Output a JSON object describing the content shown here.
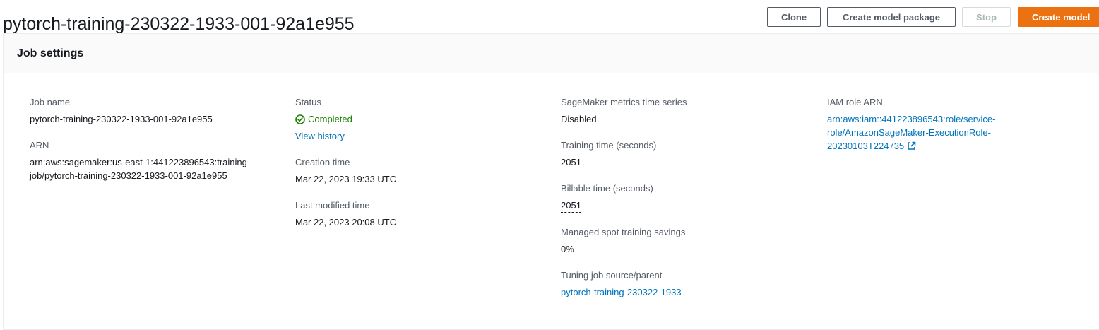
{
  "header": {
    "job_title": "pytorch-training-230322-1933-001-92a1e955",
    "buttons": {
      "clone": "Clone",
      "create_model_package": "Create model package",
      "stop": "Stop",
      "create_model": "Create model"
    },
    "colors": {
      "primary": "#ec7211",
      "link": "#0073bb",
      "success": "#1d8102"
    }
  },
  "job_settings": {
    "title": "Job settings",
    "job_name": {
      "label": "Job name",
      "value": "pytorch-training-230322-1933-001-92a1e955"
    },
    "arn": {
      "label": "ARN",
      "value_line1": "arn:aws:sagemaker:us-east-1:441223896543:training-",
      "value_line2": "job/pytorch-training-230322-1933-001-92a1e955"
    },
    "status": {
      "label": "Status",
      "value": "Completed",
      "icon": "check-circle-icon",
      "history_link": "View history"
    },
    "creation_time": {
      "label": "Creation time",
      "value": "Mar 22, 2023 19:33 UTC"
    },
    "last_modified_time": {
      "label": "Last modified time",
      "value": "Mar 22, 2023 20:08 UTC"
    },
    "metrics_time_series": {
      "label": "SageMaker metrics time series",
      "value": "Disabled"
    },
    "training_time": {
      "label": "Training time (seconds)",
      "value": "2051"
    },
    "billable_time": {
      "label": "Billable time (seconds)",
      "value": "2051"
    },
    "spot_savings": {
      "label": "Managed spot training savings",
      "value": "0%"
    },
    "tuning_job": {
      "label": "Tuning job source/parent",
      "value": "pytorch-training-230322-1933"
    },
    "iam_role": {
      "label": "IAM role ARN",
      "line1": "arn:aws:iam::441223896543:role/service-",
      "line2": "role/AmazonSageMaker-ExecutionRole-",
      "line3": "20230103T224735",
      "icon": "external-link-icon"
    }
  }
}
